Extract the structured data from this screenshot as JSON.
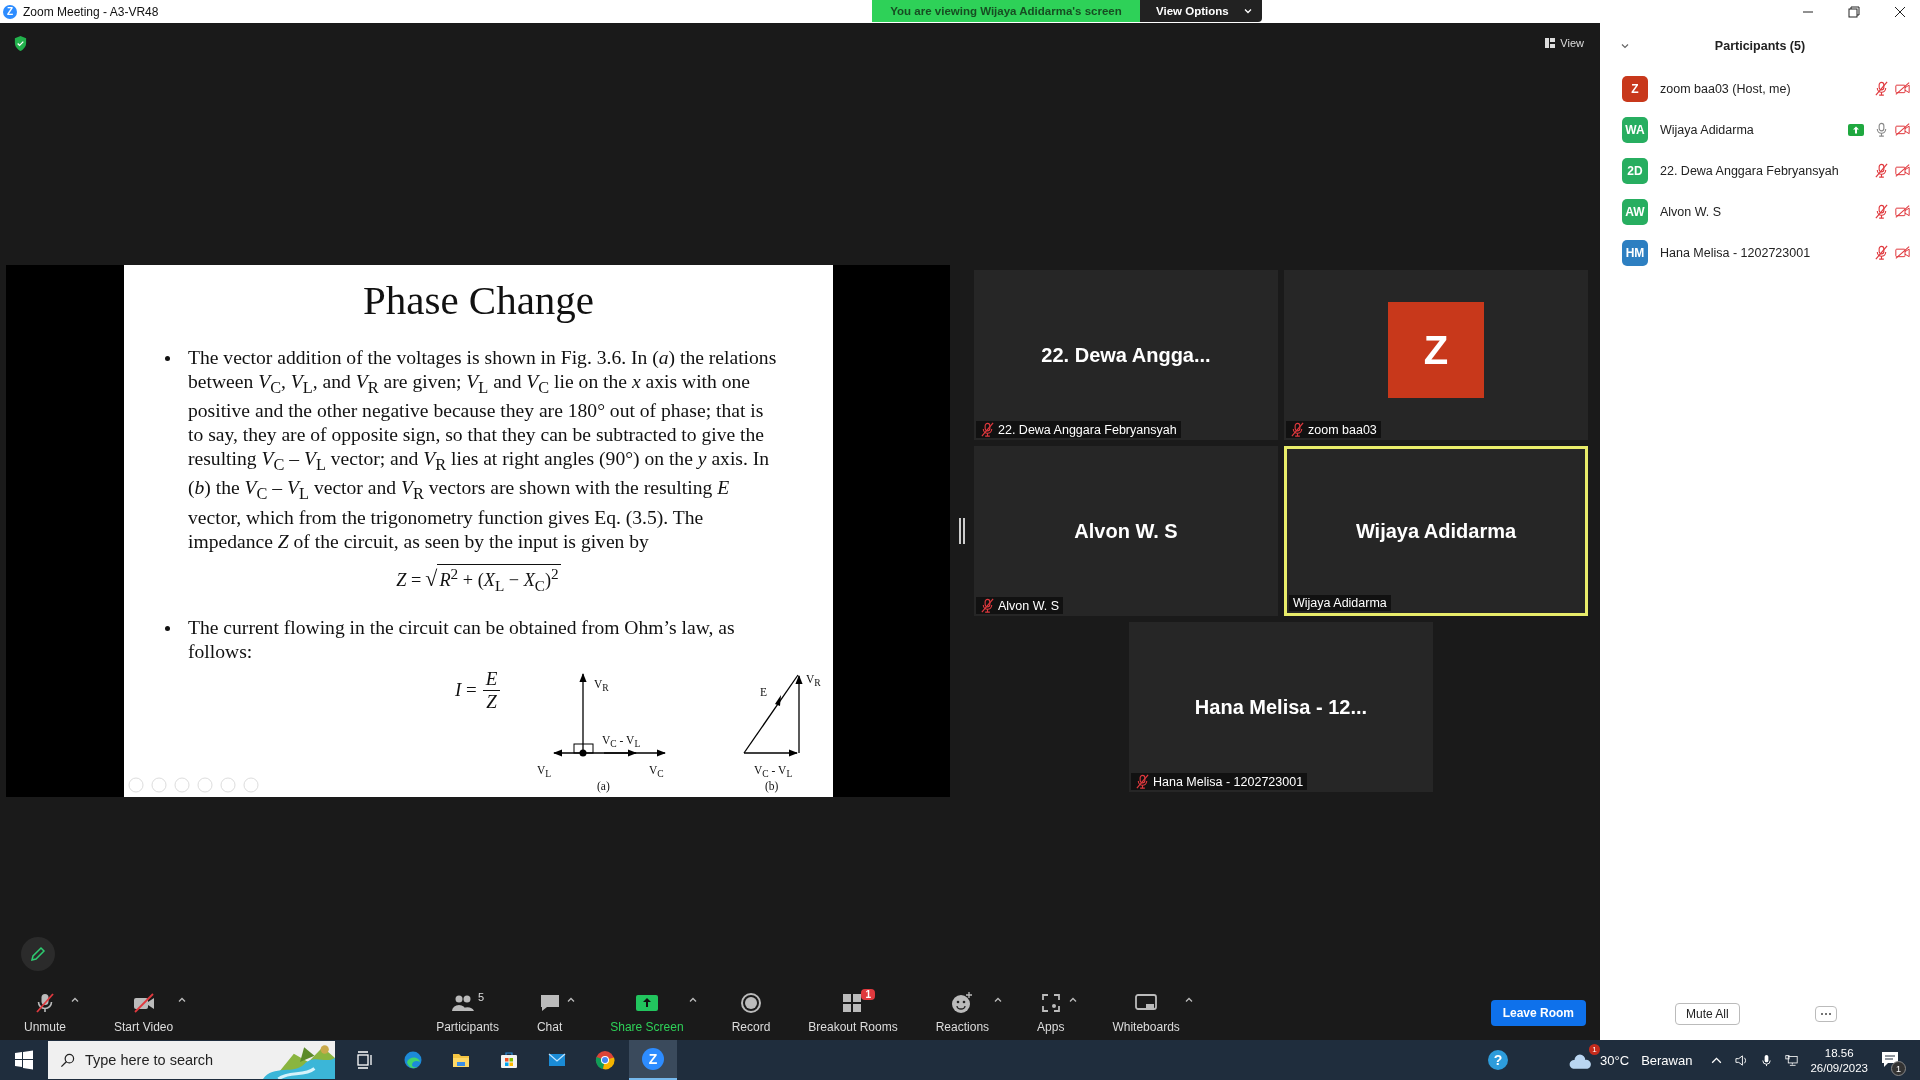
{
  "window": {
    "logo": "Z",
    "title": "Zoom Meeting - A3-VR48"
  },
  "banner": {
    "text": "You are viewing Wijaya Adidarma's screen",
    "options": "View Options"
  },
  "view_button": "View",
  "slide": {
    "title": "Phase Change",
    "paragraphs": [
      "The vector addition of the voltages is shown in Fig. 3.6. In (*a*) the relations between *V*$_{C}$, *V*$_{L}$, and *V*$_{R}$ are given; *V*$_{L}$ and *V*$_{C}$ lie on the *x* axis with one positive and the other negative because they are 180° out of phase; that is to say, they are of opposite sign, so that they can be subtracted to give the resulting *V*$_{C}$ – *V*$_{L}$ vector; and *V*$_{R}$ lies at right angles (90°) on the *y* axis. In (*b*) the *V*$_{C}$ – *V*$_{L}$ vector and *V*$_{R}$ vectors are shown with the resulting *E* vector, which from the trigonometry function gives Eq. (3.5). The impedance *Z* of the circuit, as seen by the input is given by",
      "The current flowing in the circuit can be obtained from Ohm’s law, as follows:"
    ],
    "impedance_formula": {
      "lhs": "*Z* =",
      "radical": "√",
      "radicand": "*R*$^{2}$ + (*X*$_{L}$ − *X*$_{C}$)$^{2}$"
    },
    "current_formula": {
      "lhs": "*I* =",
      "numerator": "*E*",
      "denominator": "*Z*"
    },
    "diagram_a": {
      "up": "V$_{R}$",
      "middle": "V$_{C}$ - V$_{L}$",
      "left": "V$_{L}$",
      "right": "V$_{C}$",
      "caption": "(a)"
    },
    "diagram_b": {
      "hypotenuse": "E",
      "top": "V$_{R}$",
      "base": "V$_{C}$ - V$_{L}$",
      "caption": "(b)"
    }
  },
  "tiles": [
    {
      "kind": "name",
      "display": "22. Dewa Angga...",
      "label": "22. Dewa Anggara Febryansyah",
      "muted": true,
      "speaking": false
    },
    {
      "kind": "avatar",
      "display": "Z",
      "color": "#c8381b",
      "label": "zoom baa03",
      "muted": true,
      "speaking": false
    },
    {
      "kind": "name",
      "display": "Alvon W. S",
      "label": "Alvon W. S",
      "muted": true,
      "speaking": false
    },
    {
      "kind": "name",
      "display": "Wijaya Adidarma",
      "label": "Wijaya Adidarma",
      "muted": false,
      "speaking": true
    },
    {
      "kind": "name",
      "display": "Hana Melisa - 12...",
      "label": "Hana Melisa - 1202723001",
      "muted": true,
      "speaking": false
    }
  ],
  "toolbar": [
    {
      "kind": "mic",
      "label": "Unmute",
      "caret": true
    },
    {
      "kind": "video",
      "label": "Start Video",
      "caret": true
    },
    {
      "kind": "participants",
      "label": "Participants",
      "count": "5",
      "caret": false
    },
    {
      "kind": "chat",
      "label": "Chat",
      "caret": true
    },
    {
      "kind": "share",
      "label": "Share Screen",
      "caret": true
    },
    {
      "kind": "record",
      "label": "Record",
      "caret": false
    },
    {
      "kind": "breakout",
      "label": "Breakout Rooms",
      "badge": "1",
      "caret": false
    },
    {
      "kind": "reactions",
      "label": "Reactions",
      "caret": true
    },
    {
      "kind": "apps",
      "label": "Apps",
      "caret": true
    },
    {
      "kind": "whiteboards",
      "label": "Whiteboards",
      "caret": true
    }
  ],
  "leave_button": "Leave Room",
  "participants_panel": {
    "title": "Participants (5)",
    "participants": [
      {
        "initials": "Z",
        "name": "zoom baa03 (Host, me)",
        "color": "#c8381b",
        "sharing": false,
        "muted": true,
        "video_off": true
      },
      {
        "initials": "WA",
        "name": "Wijaya Adidarma",
        "color": "#27ae60",
        "sharing": true,
        "muted": false,
        "video_off": true
      },
      {
        "initials": "2D",
        "name": "22. Dewa Anggara Febryansyah",
        "color": "#27ae60",
        "sharing": false,
        "muted": true,
        "video_off": true
      },
      {
        "initials": "AW",
        "name": "Alvon W. S",
        "color": "#27ae60",
        "sharing": false,
        "muted": true,
        "video_off": true
      },
      {
        "initials": "HM",
        "name": "Hana Melisa - 1202723001",
        "color": "#2d7fc1",
        "sharing": false,
        "muted": true,
        "video_off": true
      }
    ],
    "mute_all": "Mute All"
  },
  "taskbar": {
    "search_placeholder": "Type here to search",
    "zoom_logo": "Z",
    "help_glyph": "?",
    "weather_badge": "1",
    "temperature": "30°C",
    "weather": "Berawan",
    "time": "18.56",
    "date": "26/09/2023",
    "notification_count": "1"
  }
}
